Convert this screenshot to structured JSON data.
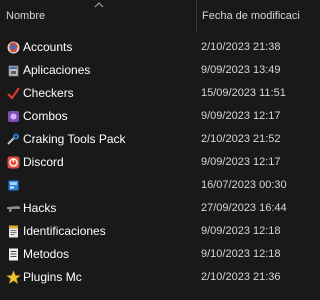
{
  "columns": {
    "name_label": "Nombre",
    "date_label": "Fecha de modificación"
  },
  "files": [
    {
      "name": "Accounts",
      "date": "2/10/2023 21:38",
      "icon": "world-app-icon"
    },
    {
      "name": "Aplicaciones",
      "date": "9/09/2023 13:49",
      "icon": "application-icon"
    },
    {
      "name": "Checkers",
      "date": "15/09/2023 11:51",
      "icon": "checkmark-icon"
    },
    {
      "name": "Combos",
      "date": "9/09/2023 12:17",
      "icon": "combos-icon"
    },
    {
      "name": "Craking Tools Pack",
      "date": "2/10/2023 21:52",
      "icon": "tool-pack-icon"
    },
    {
      "name": "Discord",
      "date": "9/09/2023 12:17",
      "icon": "discord-icon"
    },
    {
      "name": "",
      "date": "16/07/2023 00:30",
      "icon": "blue-app-icon"
    },
    {
      "name": "Hacks",
      "date": "27/09/2023 16:44",
      "icon": "gun-icon"
    },
    {
      "name": "Identificaciones",
      "date": "9/09/2023 12:18",
      "icon": "id-document-icon"
    },
    {
      "name": "Metodos",
      "date": "9/10/2023 12:18",
      "icon": "document-icon"
    },
    {
      "name": "Plugins Mc",
      "date": "2/10/2023 21:36",
      "icon": "star-icon"
    }
  ]
}
